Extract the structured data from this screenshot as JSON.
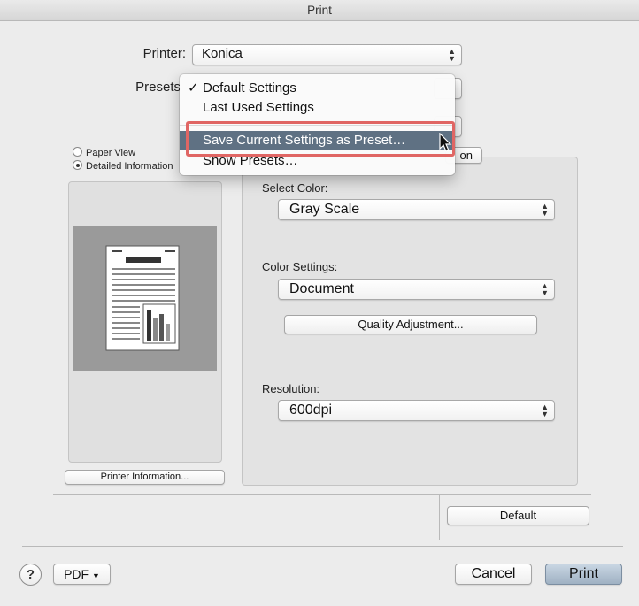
{
  "window": {
    "title": "Print"
  },
  "printer": {
    "label": "Printer:",
    "value": "Konica"
  },
  "presets": {
    "label": "Presets",
    "menu": {
      "items": [
        "Default Settings",
        "Last Used Settings",
        "Save Current Settings as Preset…",
        "Show Presets…"
      ],
      "checked_index": 0,
      "highlighted_index": 2
    }
  },
  "view": {
    "paper_view": "Paper View",
    "detailed_info": "Detailed Information",
    "selected": "Detailed Information"
  },
  "tab_fragment": "on",
  "color": {
    "select_color_label": "Select Color:",
    "select_color_value": "Gray Scale",
    "settings_label": "Color Settings:",
    "settings_value": "Document",
    "quality_button": "Quality Adjustment..."
  },
  "resolution": {
    "label": "Resolution:",
    "value": "600dpi"
  },
  "buttons": {
    "printer_information": "Printer Information...",
    "default": "Default",
    "help": "?",
    "pdf": "PDF",
    "cancel": "Cancel",
    "print": "Print"
  },
  "colors": {
    "menu_highlight": "#5f7183",
    "annotation_box": "#e06664",
    "preview_bg": "#9a9a9a"
  }
}
